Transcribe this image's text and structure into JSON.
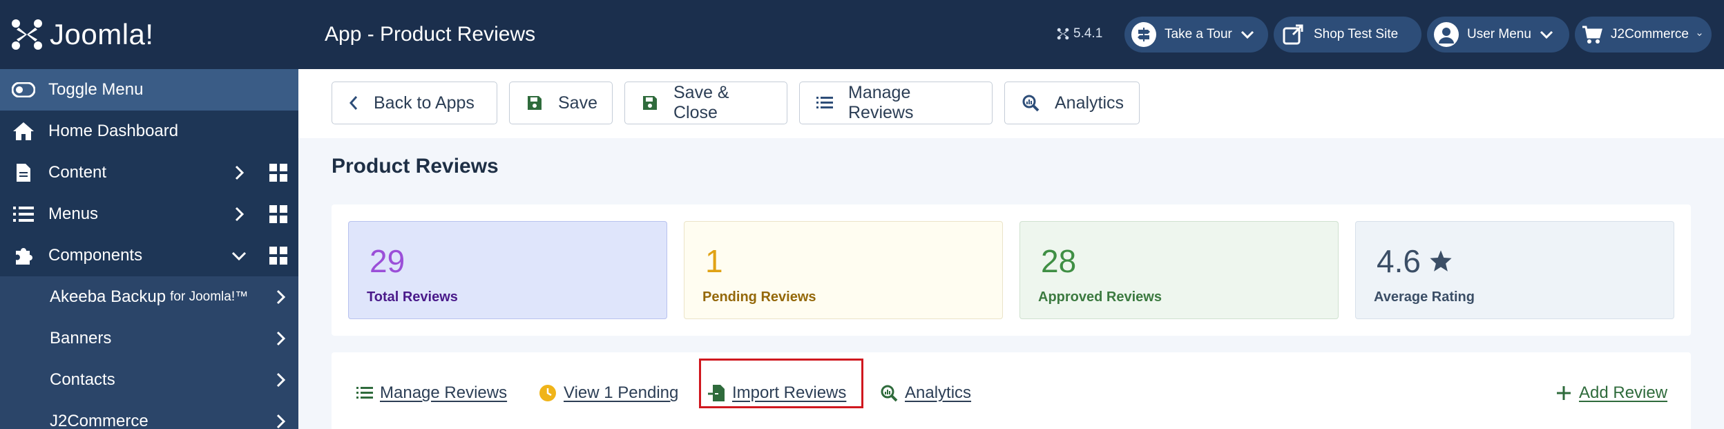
{
  "brand": {
    "name": "Joomla!"
  },
  "sidebar": {
    "toggle_label": "Toggle Menu",
    "items": [
      {
        "label": "Home Dashboard",
        "icon": "home-icon"
      },
      {
        "label": "Content",
        "icon": "file-icon"
      },
      {
        "label": "Menus",
        "icon": "list-icon"
      },
      {
        "label": "Components",
        "icon": "puzzle-icon"
      }
    ],
    "subitems": [
      {
        "label": "Akeeba Backup",
        "suffix": "for Joomla!™"
      },
      {
        "label": "Banners"
      },
      {
        "label": "Contacts"
      },
      {
        "label": "J2Commerce"
      }
    ]
  },
  "header": {
    "title": "App - Product Reviews",
    "version": "5.4.1",
    "buttons": [
      {
        "label": "Take a Tour",
        "icon": "signpost-icon"
      },
      {
        "label": "Shop Test Site",
        "icon": "external-link-icon"
      },
      {
        "label": "User Menu",
        "icon": "user-icon"
      },
      {
        "label": "J2Commerce",
        "icon": "cart-icon"
      }
    ]
  },
  "toolbar": {
    "back": "Back to Apps",
    "save": "Save",
    "save_close": "Save & Close",
    "manage": "Manage Reviews",
    "analytics": "Analytics"
  },
  "main": {
    "title": "Product Reviews",
    "stats": [
      {
        "value": "29",
        "label": "Total Reviews",
        "bg": "#dfe5fb",
        "border": "#b8c2ee",
        "num_color": "#9b4fd8",
        "label_color": "#4a1a8a"
      },
      {
        "value": "1",
        "label": "Pending Reviews",
        "bg": "#fffdf1",
        "border": "#ebe4c8",
        "num_color": "#e0a214",
        "label_color": "#94680a"
      },
      {
        "value": "28",
        "label": "Approved Reviews",
        "bg": "#eef6ee",
        "border": "#cfe1cf",
        "num_color": "#3f8f44",
        "label_color": "#3c7a40"
      },
      {
        "value": "4.6",
        "label": "Average Rating",
        "bg": "#eef3f8",
        "border": "#d7e0ea",
        "num_color": "#3b4e66",
        "label_color": "#3b4e66"
      }
    ],
    "links": {
      "manage": "Manage Reviews",
      "pending": "View 1 Pending",
      "import": "Import Reviews",
      "analytics": "Analytics",
      "add": "Add Review"
    }
  }
}
